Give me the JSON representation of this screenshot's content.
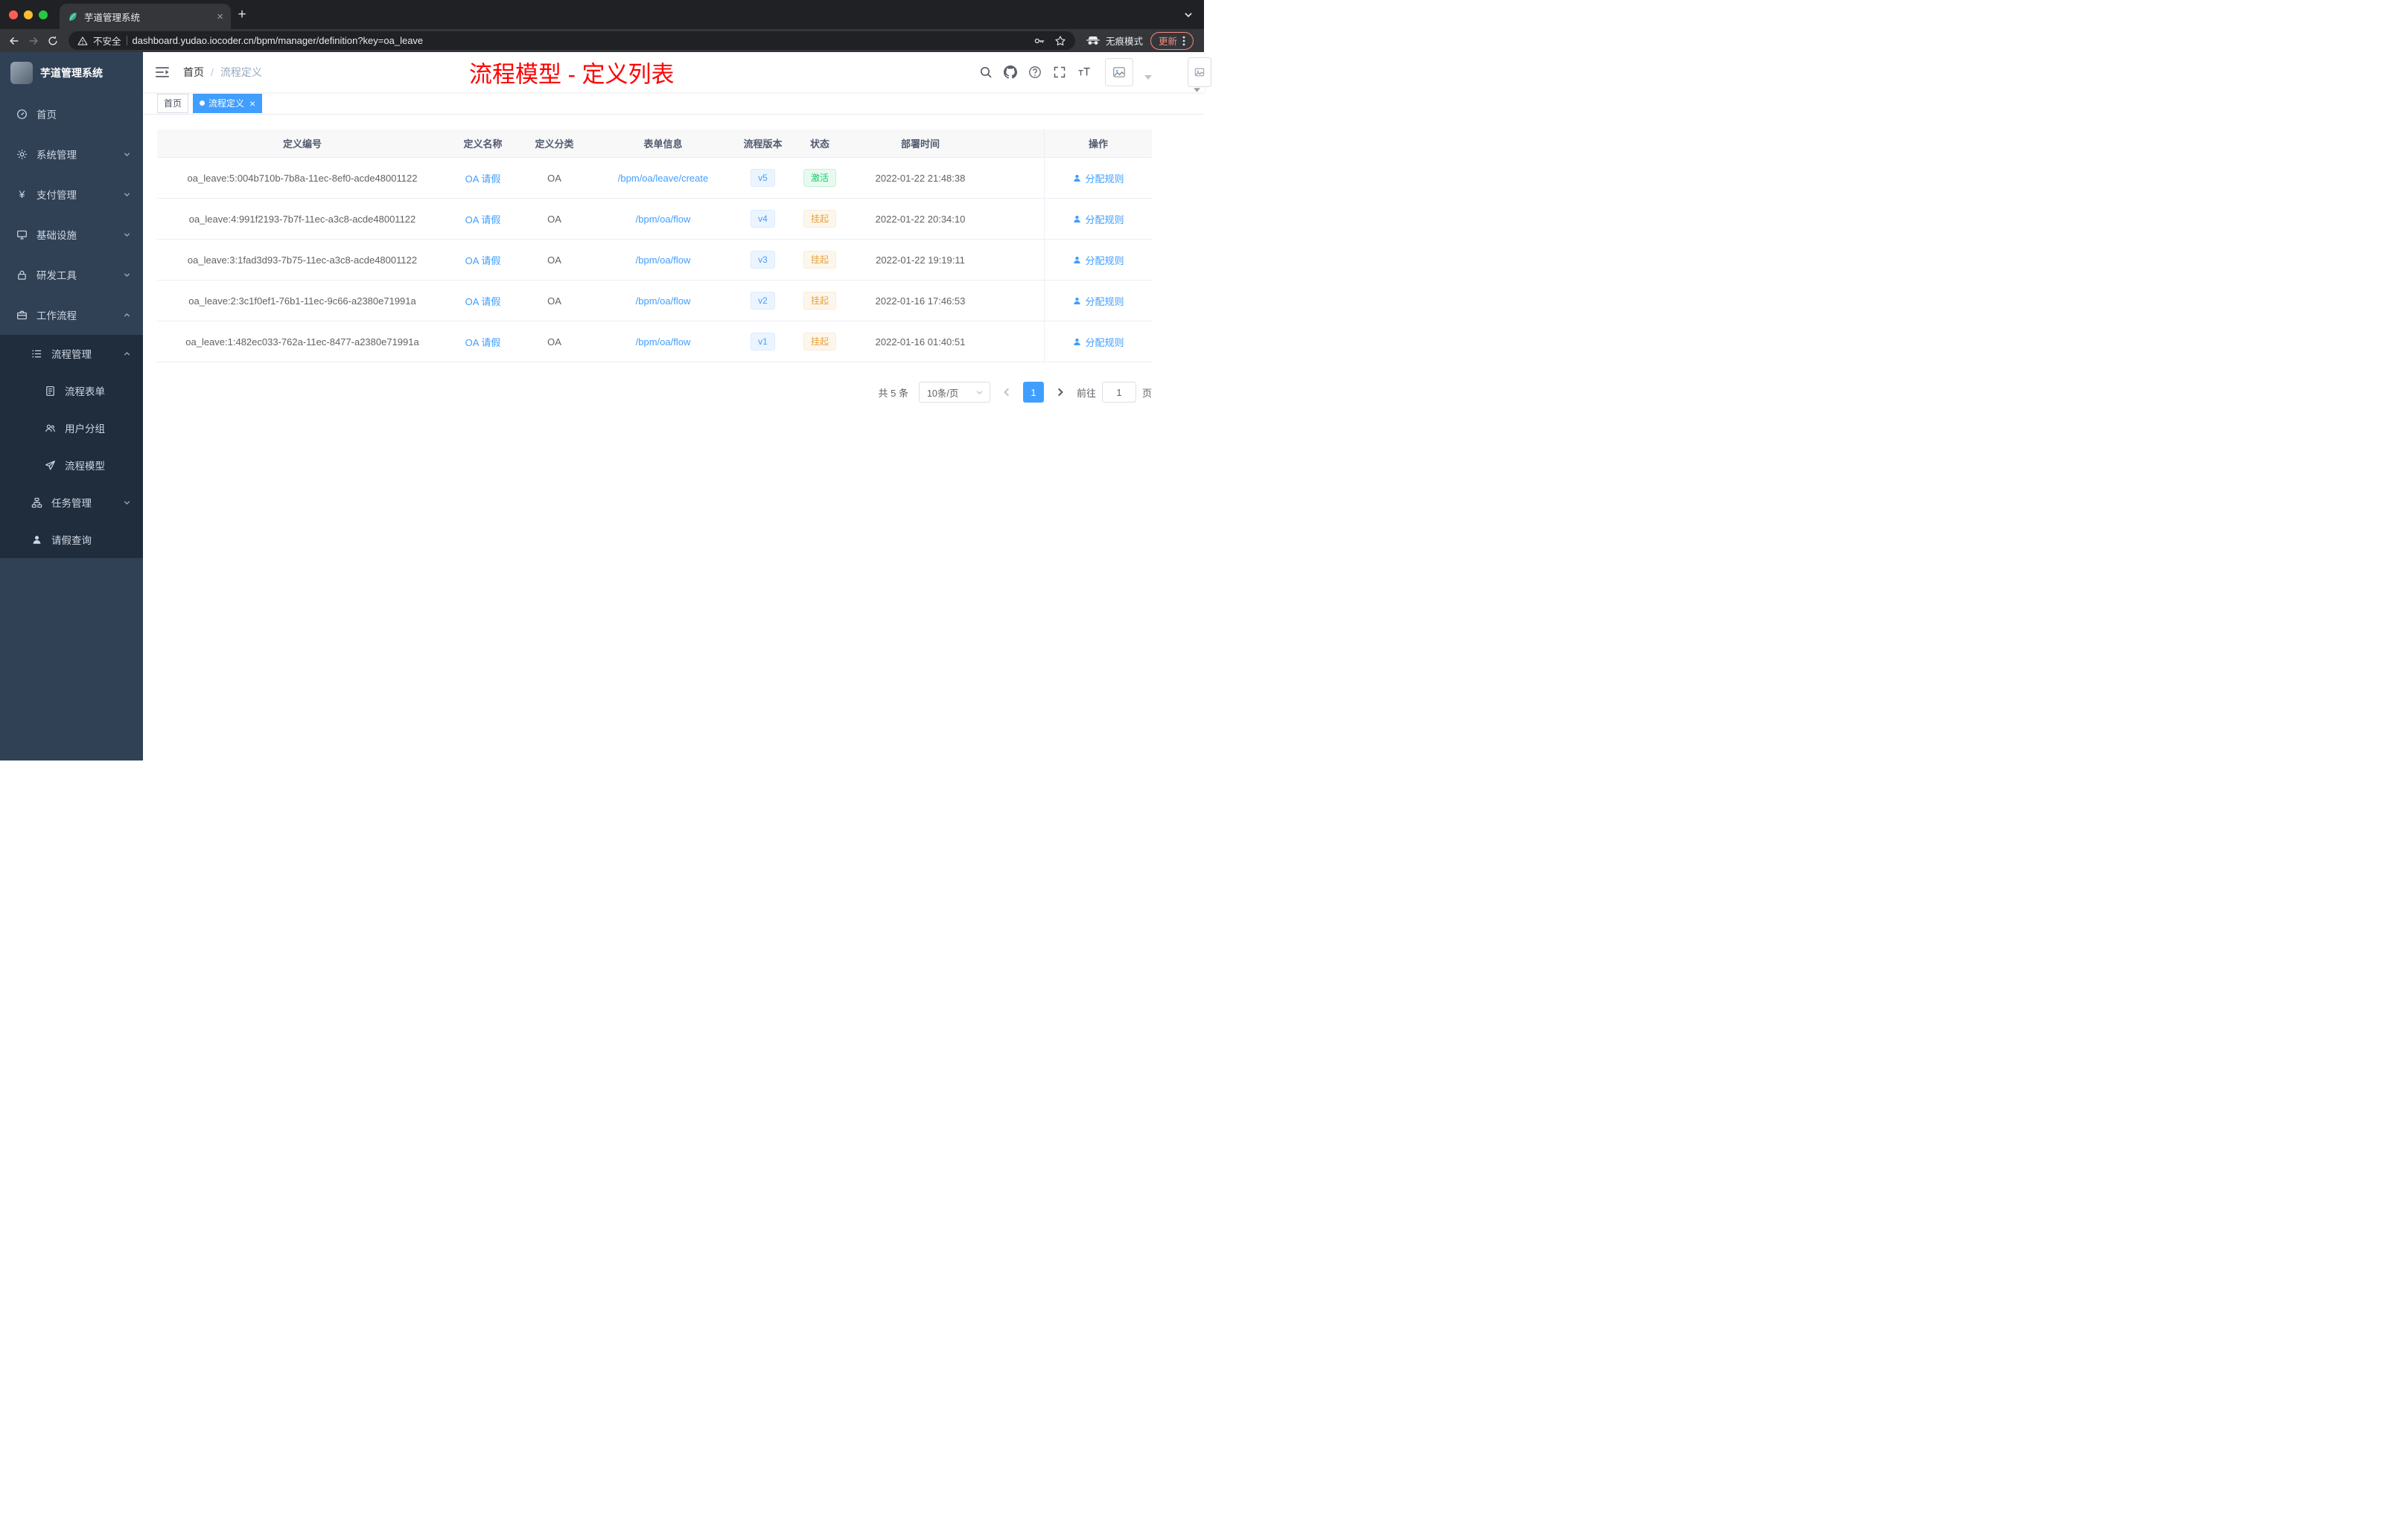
{
  "browser": {
    "tab_title": "芋道管理系统",
    "security_label": "不安全",
    "url": "dashboard.yudao.iocoder.cn/bpm/manager/definition?key=oa_leave",
    "incognito_label": "无痕模式",
    "update_label": "更新"
  },
  "sidebar": {
    "logo_title": "芋道管理系统",
    "menu": [
      {
        "label": "首页",
        "icon": "dashboard-icon",
        "indent": 1,
        "chevron": "",
        "dark": false
      },
      {
        "label": "系统管理",
        "icon": "gear-icon",
        "indent": 1,
        "chevron": "down",
        "dark": false
      },
      {
        "label": "支付管理",
        "icon": "yen-icon",
        "indent": 1,
        "chevron": "down",
        "dark": false
      },
      {
        "label": "基础设施",
        "icon": "monitor-icon",
        "indent": 1,
        "chevron": "down",
        "dark": false
      },
      {
        "label": "研发工具",
        "icon": "tool-icon",
        "indent": 1,
        "chevron": "down",
        "dark": false
      },
      {
        "label": "工作流程",
        "icon": "briefcase-icon",
        "indent": 1,
        "chevron": "up",
        "dark": false
      },
      {
        "label": "流程管理",
        "icon": "list-icon",
        "indent": 2,
        "chevron": "up",
        "dark": true
      },
      {
        "label": "流程表单",
        "icon": "form-icon",
        "indent": 3,
        "chevron": "",
        "dark": true
      },
      {
        "label": "用户分组",
        "icon": "usergroup-icon",
        "indent": 3,
        "chevron": "",
        "dark": true
      },
      {
        "label": "流程模型",
        "icon": "plane-icon",
        "indent": 3,
        "chevron": "",
        "dark": true
      },
      {
        "label": "任务管理",
        "icon": "orgchart-icon",
        "indent": 2,
        "chevron": "down",
        "dark": true
      },
      {
        "label": "请假查询",
        "icon": "user-icon",
        "indent": 2,
        "chevron": "",
        "dark": true
      }
    ]
  },
  "header": {
    "breadcrumb": {
      "home": "首页",
      "separator": "/",
      "current": "流程定义"
    },
    "overlay_title": "流程模型 - 定义列表",
    "icons": [
      "search-icon",
      "github-icon",
      "question-icon",
      "fullscreen-icon",
      "fontsize-icon"
    ]
  },
  "tags_view": [
    {
      "label": "首页",
      "active": false,
      "closable": false
    },
    {
      "label": "流程定义",
      "active": true,
      "closable": true
    }
  ],
  "table": {
    "columns": [
      "定义编号",
      "定义名称",
      "定义分类",
      "表单信息",
      "流程版本",
      "状态",
      "部署时间",
      "操作"
    ],
    "rows": [
      {
        "id": "oa_leave:5:004b710b-7b8a-11ec-8ef0-acde48001122",
        "name": "OA 请假",
        "category": "OA",
        "form": "/bpm/oa/leave/create",
        "version": "v5",
        "status": "激活",
        "status_type": "active",
        "deploy_time": "2022-01-22 21:48:38",
        "action": "分配规则"
      },
      {
        "id": "oa_leave:4:991f2193-7b7f-11ec-a3c8-acde48001122",
        "name": "OA 请假",
        "category": "OA",
        "form": "/bpm/oa/flow",
        "version": "v4",
        "status": "挂起",
        "status_type": "suspend",
        "deploy_time": "2022-01-22 20:34:10",
        "action": "分配规则"
      },
      {
        "id": "oa_leave:3:1fad3d93-7b75-11ec-a3c8-acde48001122",
        "name": "OA 请假",
        "category": "OA",
        "form": "/bpm/oa/flow",
        "version": "v3",
        "status": "挂起",
        "status_type": "suspend",
        "deploy_time": "2022-01-22 19:19:11",
        "action": "分配规则"
      },
      {
        "id": "oa_leave:2:3c1f0ef1-76b1-11ec-9c66-a2380e71991a",
        "name": "OA 请假",
        "category": "OA",
        "form": "/bpm/oa/flow",
        "version": "v2",
        "status": "挂起",
        "status_type": "suspend",
        "deploy_time": "2022-01-16 17:46:53",
        "action": "分配规则"
      },
      {
        "id": "oa_leave:1:482ec033-762a-11ec-8477-a2380e71991a",
        "name": "OA 请假",
        "category": "OA",
        "form": "/bpm/oa/flow",
        "version": "v1",
        "status": "挂起",
        "status_type": "suspend",
        "deploy_time": "2022-01-16 01:40:51",
        "action": "分配规则"
      }
    ]
  },
  "pagination": {
    "total": "共 5 条",
    "page_size": "10条/页",
    "page": "1",
    "goto_label": "前往",
    "goto_value": "1",
    "goto_unit": "页"
  },
  "colors": {
    "primary": "#409eff",
    "annotation_red": "#ff0000",
    "status_active_green": "#13ce66",
    "status_suspend_orange": "#e6a23c",
    "sidebar_bg": "#304156",
    "sidebar_submenu_bg": "#1f2d3d"
  }
}
